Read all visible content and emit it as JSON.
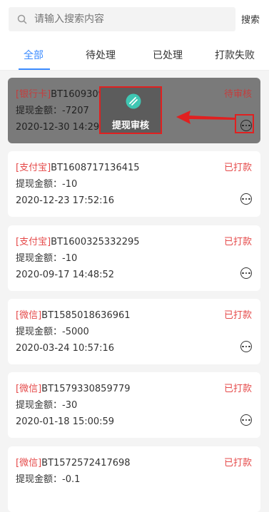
{
  "search": {
    "placeholder": "请输入搜索内容",
    "button_label": "搜索"
  },
  "tabs": [
    {
      "label": "全部",
      "active": true
    },
    {
      "label": "待处理",
      "active": false
    },
    {
      "label": "已处理",
      "active": false
    },
    {
      "label": "打款失败",
      "active": false
    }
  ],
  "colors": {
    "accent": "#3b8bff",
    "status_red": "#e54a4a",
    "highlight_red": "#e02020"
  },
  "records": [
    {
      "type": "[银行卡]",
      "id": "BT1609309754614",
      "amount_label": "提现金额：",
      "amount": "-7207",
      "datetime": "2020-12-30 14:29:14",
      "status": "待审核"
    },
    {
      "type": "[支付宝]",
      "id": "BT1608717136415",
      "amount_label": "提现金额：",
      "amount": "-10",
      "datetime": "2020-12-23 17:52:16",
      "status": "已打款"
    },
    {
      "type": "[支付宝]",
      "id": "BT1600325332295",
      "amount_label": "提现金额：",
      "amount": "-10",
      "datetime": "2020-09-17 14:48:52",
      "status": "已打款"
    },
    {
      "type": "[微信]",
      "id": "BT1585018636961",
      "amount_label": "提现金额：",
      "amount": "-5000",
      "datetime": "2020-03-24 10:57:16",
      "status": "已打款"
    },
    {
      "type": "[微信]",
      "id": "BT1579330859779",
      "amount_label": "提现金额：",
      "amount": "-30",
      "datetime": "2020-01-18 15:00:59",
      "status": "已打款"
    },
    {
      "type": "[微信]",
      "id": "BT1572572417698",
      "amount_label": "提现金额：",
      "amount": "-0.1",
      "datetime": "",
      "status": "已打款"
    }
  ],
  "popup": {
    "label": "提现审核",
    "icon": "review-icon"
  }
}
